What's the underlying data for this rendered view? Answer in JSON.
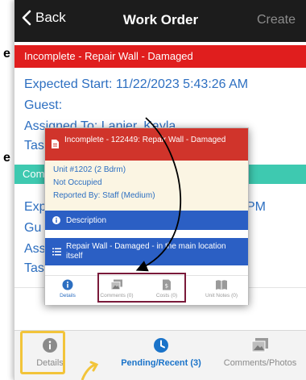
{
  "slide_fragments": {
    "top_letter": "e",
    "mid_letter": "e"
  },
  "navbar": {
    "back_label": "Back",
    "title": "Work Order",
    "create_label": "Create"
  },
  "card1": {
    "status_banner": "Incomplete -  Repair Wall - Damaged",
    "expected_start": "Expected Start: 11/22/2023 5:43:26 AM",
    "guest": "Guest:",
    "assigned_to": "Assigned To: Lanier, Kayla",
    "task_fragment": "Tas"
  },
  "card2": {
    "status_fragment": "Com",
    "expected_fragment": "Exp",
    "expected_tail": "PM",
    "guest_fragment": "Gu",
    "assigned_fragment": "Ass",
    "task_fragment": "Tas"
  },
  "popup": {
    "header": "Incomplete - 122449: Repair Wall - Damaged",
    "unit": "Unit #1202 (2 Bdrm)",
    "occupancy": "Not Occupied",
    "reported_by": "Reported By: Staff  (Medium)",
    "description_label": "Description",
    "description_text": "Repair Wall - Damaged - in the main location itself",
    "tabs": [
      {
        "label": "Details",
        "icon": "info-icon"
      },
      {
        "label": "Comments (0)",
        "icon": "photos-icon"
      },
      {
        "label": "Costs (0)",
        "icon": "receipt-icon"
      },
      {
        "label": "Unit Notes (0)",
        "icon": "book-icon"
      }
    ]
  },
  "tabbar": {
    "tabs": [
      {
        "label": "Details",
        "icon": "info-icon"
      },
      {
        "label": "Pending/Recent (3)",
        "icon": "clock-icon"
      },
      {
        "label": "Comments/Photos",
        "icon": "photos-icon"
      }
    ]
  },
  "colors": {
    "navbar_bg": "#1c1c1c",
    "status_red": "#e01e1e",
    "status_teal": "#3ec9b0",
    "link_blue": "#2d6fc1",
    "popup_bar_blue": "#2b5fc4",
    "highlight_yellow": "#f2c43a",
    "annotation_maroon": "#7a1a3a"
  }
}
